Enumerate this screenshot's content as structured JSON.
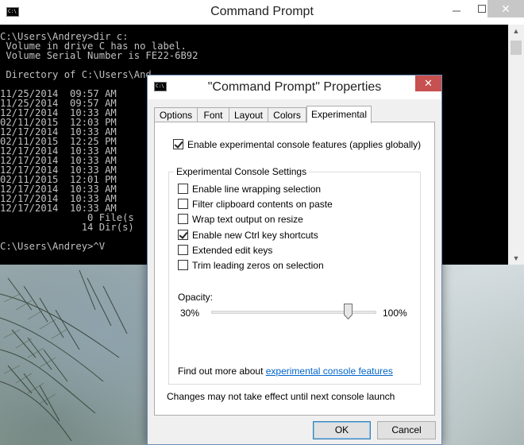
{
  "cmd_window": {
    "title": "Command Prompt",
    "icon": "console-app-icon",
    "console_lines": [
      "C:\\Users\\Andrey>dir c:",
      " Volume in drive C has no label.",
      " Volume Serial Number is FE22-6B92",
      "",
      " Directory of C:\\Users\\And",
      "",
      "11/25/2014  09:57 AM",
      "11/25/2014  09:57 AM",
      "12/17/2014  10:33 AM",
      "02/11/2015  12:03 PM",
      "12/17/2014  10:33 AM",
      "02/11/2015  12:25 PM",
      "12/17/2014  10:33 AM",
      "12/17/2014  10:33 AM",
      "12/17/2014  10:33 AM",
      "02/11/2015  12:01 PM",
      "12/17/2014  10:33 AM",
      "12/17/2014  10:33 AM",
      "12/17/2014  10:33 AM",
      "               0 File(s",
      "              14 Dir(s)",
      "",
      "C:\\Users\\Andrey>^V"
    ]
  },
  "dialog": {
    "title": "\"Command Prompt\" Properties",
    "close_glyph": "✕",
    "tabs": [
      {
        "label": "Options",
        "active": false
      },
      {
        "label": "Font",
        "active": false
      },
      {
        "label": "Layout",
        "active": false
      },
      {
        "label": "Colors",
        "active": false
      },
      {
        "label": "Experimental",
        "active": true
      }
    ],
    "enable_experimental": {
      "label": "Enable experimental console features (applies globally)",
      "checked": true
    },
    "group_title": "Experimental Console Settings",
    "options": [
      {
        "label": "Enable line wrapping selection",
        "checked": false
      },
      {
        "label": "Filter clipboard contents on paste",
        "checked": false
      },
      {
        "label": "Wrap text output on resize",
        "checked": false
      },
      {
        "label": "Enable new Ctrl key shortcuts",
        "checked": true
      },
      {
        "label": "Extended edit keys",
        "checked": false
      },
      {
        "label": "Trim leading zeros on selection",
        "checked": false
      }
    ],
    "opacity": {
      "label": "Opacity:",
      "min_label": "30%",
      "max_label": "100%",
      "value_fraction": 0.85
    },
    "find_out_prefix": "Find out more about ",
    "find_out_link": "experimental console features",
    "note": "Changes may not take effect until next console launch",
    "buttons": {
      "ok": "OK",
      "cancel": "Cancel"
    }
  }
}
